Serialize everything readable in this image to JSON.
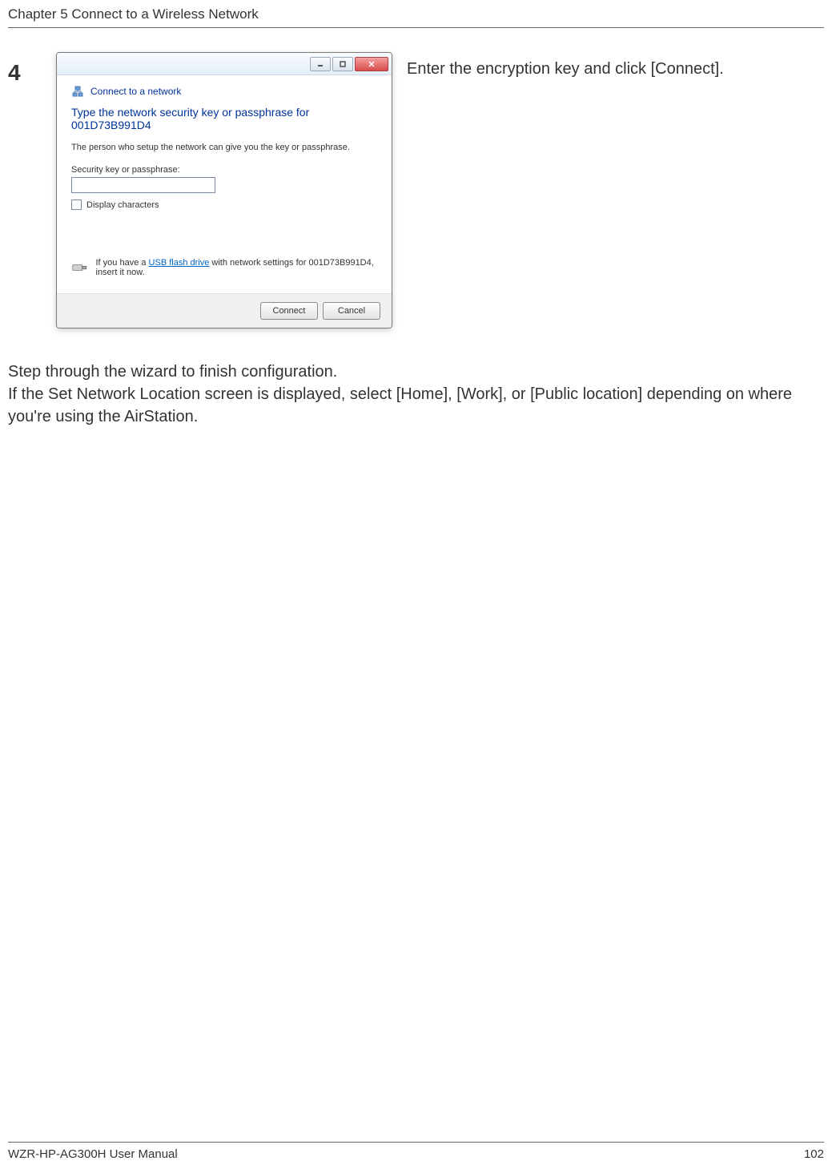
{
  "header": {
    "chapter_title": "Chapter 5  Connect to a Wireless Network"
  },
  "step": {
    "number": "4",
    "instruction": "Enter the encryption key and click [Connect]."
  },
  "dialog": {
    "title": "Connect to a network",
    "heading": "Type the network security key or passphrase for 001D73B991D4",
    "subtext": "The person who setup the network can give you the key or passphrase.",
    "field_label": "Security key or passphrase:",
    "input_value": "",
    "checkbox_label": "Display characters",
    "usb_prefix": "If you have a ",
    "usb_link": "USB flash drive",
    "usb_suffix": " with network settings for 001D73B991D4, insert it now.",
    "connect_label": "Connect",
    "cancel_label": "Cancel"
  },
  "body": {
    "line1": "Step through the wizard to finish configuration.",
    "line2": "If the Set Network Location screen is displayed, select [Home], [Work], or [Public location] depending on where you're using the AirStation."
  },
  "footer": {
    "manual_name": "WZR-HP-AG300H User Manual",
    "page_number": "102"
  }
}
